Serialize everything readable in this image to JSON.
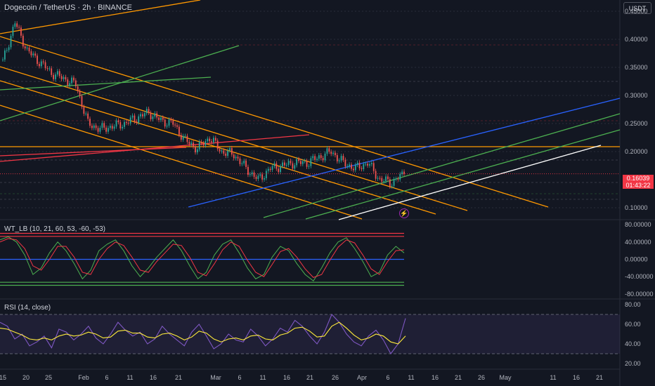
{
  "header": {
    "title": "Dogecoin / TetherUS · 2h · BINANCE",
    "currency_button": "USDT",
    "wt_label": "WT_LB (10, 21, 60, 53, -60, -53)",
    "rsi_label": "RSI (14, close)"
  },
  "price_badge": {
    "price": "0.16039",
    "countdown": "01:43:22"
  },
  "colors": {
    "background": "#131722",
    "orange": "#ff9800",
    "green": "#4caf50",
    "blue": "#2962ff",
    "red": "#f23645",
    "white": "#ffffff",
    "purple": "#7e57c2",
    "yellow": "#ffeb3b"
  },
  "icons": {
    "alert": "lightning-bolt-icon"
  },
  "chart_data": [
    {
      "type": "line",
      "title": "Dogecoin / TetherUS · 2h · BINANCE",
      "ylim": [
        0.08,
        0.47
      ],
      "y_ticks": [
        "0.45000",
        "0.40000",
        "0.35000",
        "0.30000",
        "0.25000",
        "0.20000",
        "0.10000"
      ],
      "x_ticks": [
        "15",
        "20",
        "25",
        "Feb",
        "6",
        "11",
        "16",
        "21",
        "Mar",
        "6",
        "11",
        "16",
        "21",
        "26",
        "Apr",
        "6",
        "11",
        "16",
        "21",
        "26",
        "May",
        "11",
        "16",
        "21"
      ],
      "x": [
        "Jan 15",
        "Jan 17",
        "Jan 20",
        "Jan 23",
        "Jan 25",
        "Jan 28",
        "Feb 1",
        "Feb 3",
        "Feb 6",
        "Feb 9",
        "Feb 11",
        "Feb 14",
        "Feb 16",
        "Feb 19",
        "Feb 21",
        "Feb 24",
        "Feb 27",
        "Mar 1",
        "Mar 3",
        "Mar 6",
        "Mar 9",
        "Mar 11",
        "Mar 14",
        "Mar 16",
        "Mar 19",
        "Mar 21",
        "Mar 24",
        "Mar 26",
        "Mar 29",
        "Apr 1",
        "Apr 3",
        "Apr 6",
        "Apr 8",
        "Apr 10"
      ],
      "series": [
        {
          "values": [
            0.36,
            0.43,
            0.38,
            0.36,
            0.34,
            0.33,
            0.32,
            0.25,
            0.24,
            0.245,
            0.25,
            0.26,
            0.27,
            0.255,
            0.25,
            0.22,
            0.205,
            0.225,
            0.2,
            0.195,
            0.17,
            0.15,
            0.17,
            0.175,
            0.18,
            0.18,
            0.19,
            0.2,
            0.18,
            0.17,
            0.18,
            0.15,
            0.145,
            0.16039
          ]
        }
      ],
      "last_price": 0.16039,
      "horizontal_lines": [
        0.217
      ]
    },
    {
      "type": "line",
      "title": "WT_LB (10, 21, 60, 53, -60, -53)",
      "ylim": [
        -90,
        90
      ],
      "y_ticks": [
        "80.00000",
        "40.00000",
        "0.00000",
        "-40.00000",
        "-80.00000"
      ],
      "levels": [
        60,
        53,
        0,
        -53,
        -60
      ],
      "series": [
        {
          "values": [
            45,
            52,
            40,
            10,
            -35,
            -20,
            15,
            40,
            20,
            -10,
            -45,
            -25,
            20,
            35,
            45,
            20,
            -15,
            -40,
            -20,
            5,
            25,
            45,
            20,
            -15,
            -45,
            -30,
            10,
            35,
            45,
            15,
            -20,
            -45,
            -35,
            5,
            30,
            20,
            -10,
            -35,
            -50,
            -20,
            15,
            40,
            50,
            25,
            -5,
            -40,
            -30,
            10,
            30,
            15
          ]
        },
        {
          "values": [
            40,
            48,
            45,
            25,
            -15,
            -25,
            0,
            30,
            30,
            5,
            -30,
            -35,
            0,
            25,
            40,
            32,
            5,
            -25,
            -30,
            -5,
            15,
            35,
            32,
            5,
            -30,
            -38,
            -10,
            22,
            40,
            30,
            -2,
            -30,
            -40,
            -12,
            18,
            25,
            5,
            -22,
            -42,
            -35,
            -2,
            28,
            45,
            38,
            10,
            -22,
            -35,
            -5,
            20,
            22
          ]
        }
      ]
    },
    {
      "type": "line",
      "title": "RSI (14, close)",
      "ylim": [
        15,
        85
      ],
      "y_ticks": [
        "80.00",
        "60.00",
        "40.00",
        "20.00"
      ],
      "levels": [
        70,
        30
      ],
      "series": [
        {
          "name": "RSI",
          "values": [
            62,
            58,
            45,
            50,
            38,
            42,
            48,
            36,
            55,
            52,
            44,
            50,
            58,
            46,
            40,
            50,
            62,
            54,
            48,
            52,
            40,
            45,
            58,
            50,
            44,
            38,
            52,
            60,
            48,
            35,
            40,
            50,
            44,
            42,
            55,
            48,
            38,
            45,
            56,
            52,
            64,
            58,
            48,
            40,
            52,
            70,
            62,
            50,
            42,
            38,
            48,
            54,
            44,
            30,
            40,
            66
          ]
        },
        {
          "name": "MA",
          "values": [
            56,
            55,
            52,
            49,
            45,
            44,
            46,
            44,
            48,
            50,
            48,
            49,
            52,
            50,
            46,
            47,
            53,
            54,
            51,
            51,
            47,
            46,
            50,
            51,
            48,
            44,
            47,
            53,
            51,
            45,
            42,
            45,
            46,
            44,
            48,
            49,
            45,
            44,
            49,
            51,
            56,
            57,
            53,
            47,
            48,
            58,
            62,
            56,
            49,
            44,
            46,
            50,
            48,
            42,
            40,
            48
          ]
        }
      ]
    }
  ]
}
